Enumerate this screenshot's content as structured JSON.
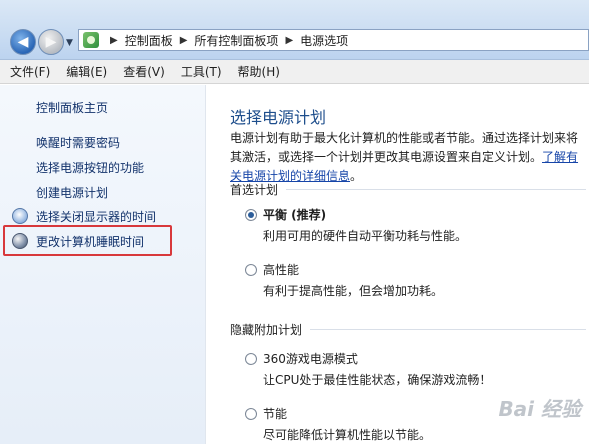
{
  "address": {
    "crumbs": [
      "控制面板",
      "所有控制面板项",
      "电源选项"
    ]
  },
  "menu": [
    "文件(F)",
    "编辑(E)",
    "查看(V)",
    "工具(T)",
    "帮助(H)"
  ],
  "sidebar": {
    "home": "控制面板主页",
    "links": [
      "唤醒时需要密码",
      "选择电源按钮的功能",
      "创建电源计划",
      "选择关闭显示器的时间",
      "更改计算机睡眠时间"
    ]
  },
  "main": {
    "title": "选择电源计划",
    "desc_text": "电源计划有助于最大化计算机的性能或者节能。通过选择计划来将其激活，或选择一个计划并更改其电源设置来自定义计划。",
    "desc_link": "了解有关电源计划的详细信息",
    "desc_end": "。",
    "preferred_header": "首选计划",
    "hidden_header": "隐藏附加计划",
    "plans": [
      {
        "name": "平衡 (推荐)",
        "desc": "利用可用的硬件自动平衡功耗与性能。",
        "checked": true
      },
      {
        "name": "高性能",
        "desc": "有利于提高性能，但会增加功耗。",
        "checked": false
      },
      {
        "name": "360游戏电源模式",
        "desc": "让CPU处于最佳性能状态，确保游戏流畅！",
        "checked": false
      },
      {
        "name": "节能",
        "desc": "尽可能降低计算机性能以节能。",
        "checked": false
      }
    ]
  },
  "watermark": "Bai 经验"
}
